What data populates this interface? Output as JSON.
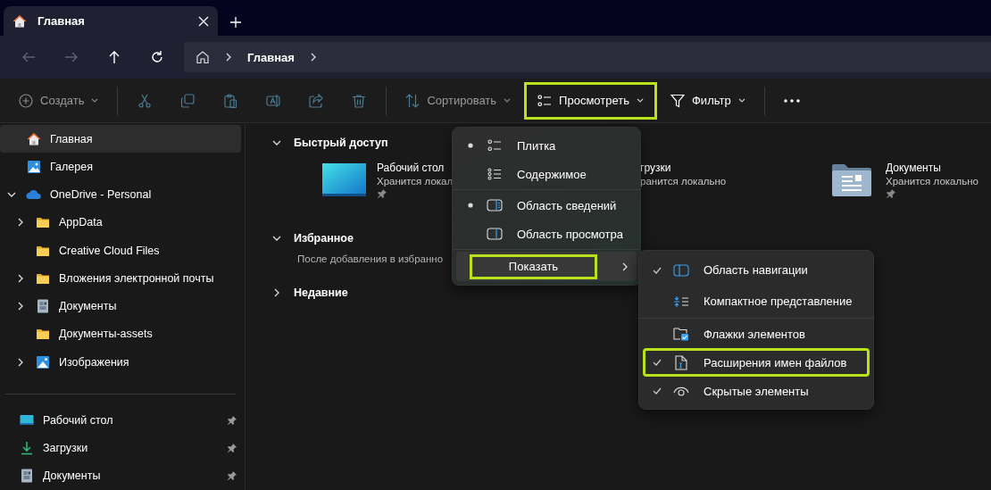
{
  "tab": {
    "title": "Главная",
    "selected": true
  },
  "navigation": {
    "buttons": [
      {
        "kind": "back",
        "disabled": true
      },
      {
        "kind": "forward",
        "disabled": true
      },
      {
        "kind": "up",
        "disabled": false
      },
      {
        "kind": "refresh",
        "disabled": false
      }
    ],
    "crumbs": [
      "Главная"
    ]
  },
  "toolbar": {
    "items": [
      {
        "kind": "create",
        "label": "Создать",
        "disabled": true,
        "highlighted": false
      },
      {
        "kind": "separator"
      },
      {
        "kind": "cut",
        "disabled": true
      },
      {
        "kind": "copy",
        "disabled": true
      },
      {
        "kind": "paste",
        "disabled": true
      },
      {
        "kind": "rename",
        "disabled": true
      },
      {
        "kind": "share",
        "disabled": true
      },
      {
        "kind": "delete",
        "disabled": true
      },
      {
        "kind": "separator"
      },
      {
        "kind": "sort",
        "label": "Сортировать",
        "disabled": true,
        "highlighted": false
      },
      {
        "kind": "view",
        "label": "Просмотреть",
        "disabled": false,
        "highlighted": true
      },
      {
        "kind": "filter",
        "label": "Фильтр",
        "disabled": false,
        "highlighted": false
      },
      {
        "kind": "separator"
      },
      {
        "kind": "more"
      }
    ]
  },
  "sidebar": {
    "items": [
      {
        "kind": "home",
        "label": "Главная",
        "selected": true
      },
      {
        "kind": "gallery",
        "label": "Галерея",
        "selected": false
      },
      {
        "kind": "cloud",
        "label": "OneDrive - Personal",
        "selected": false,
        "expanded": true,
        "children": [
          {
            "kind": "folder",
            "label": "AppData",
            "selected": false,
            "expanded": false
          },
          {
            "kind": "folder",
            "label": "Creative Cloud Files",
            "selected": false
          },
          {
            "kind": "folder",
            "label": "Вложения электронной почты",
            "selected": false,
            "expanded": false
          },
          {
            "kind": "documents",
            "label": "Документы",
            "selected": false,
            "expanded": false
          },
          {
            "kind": "folder",
            "label": "Документы-assets",
            "selected": false
          },
          {
            "kind": "pictures",
            "label": "Изображения",
            "selected": false,
            "expanded": false
          }
        ]
      }
    ],
    "pinned": [
      {
        "kind": "desktop",
        "label": "Рабочий стол",
        "pinned": true
      },
      {
        "kind": "downloads",
        "label": "Загрузки",
        "pinned": true
      },
      {
        "kind": "documents",
        "label": "Документы",
        "pinned": true
      }
    ]
  },
  "sections": [
    {
      "title": "Быстрый доступ",
      "expanded": true,
      "tiles": [
        {
          "kind": "desktop",
          "name": "Рабочий стол",
          "status": "Хранится локал",
          "pinned": true
        },
        {
          "name": "грузки",
          "status": "ранится локально"
        },
        {
          "kind": "documents",
          "name": "Документы",
          "status": "Хранится локально",
          "pinned": true
        }
      ]
    },
    {
      "title": "Избранное",
      "expanded": true,
      "message": "После добавления в избранно"
    },
    {
      "title": "Недавние",
      "expanded": false
    }
  ],
  "view_menu": {
    "items": [
      {
        "kind": "tiles",
        "label": "Плитка",
        "selected": true
      },
      {
        "kind": "content",
        "label": "Содержимое",
        "selected": false
      },
      {
        "kind": "divider"
      },
      {
        "kind": "details_pane",
        "label": "Область сведений",
        "selected": true
      },
      {
        "kind": "preview_pane",
        "label": "Область просмотра",
        "selected": false
      },
      {
        "kind": "divider"
      },
      {
        "kind": "show",
        "label": "Показать",
        "highlighted": true
      }
    ]
  },
  "show_menu": {
    "items": [
      {
        "kind": "nav_pane",
        "label": "Область навигации",
        "checked": true,
        "highlighted": false
      },
      {
        "kind": "compact",
        "label": "Компактное представление",
        "checked": false,
        "highlighted": false
      },
      {
        "kind": "divider"
      },
      {
        "kind": "checkboxes",
        "label": "Флажки элементов",
        "checked": false,
        "highlighted": false
      },
      {
        "kind": "extensions",
        "label": "Расширения имен файлов",
        "checked": true,
        "highlighted": true
      },
      {
        "kind": "hidden",
        "label": "Скрытые элементы",
        "checked": true,
        "highlighted": false
      }
    ]
  }
}
